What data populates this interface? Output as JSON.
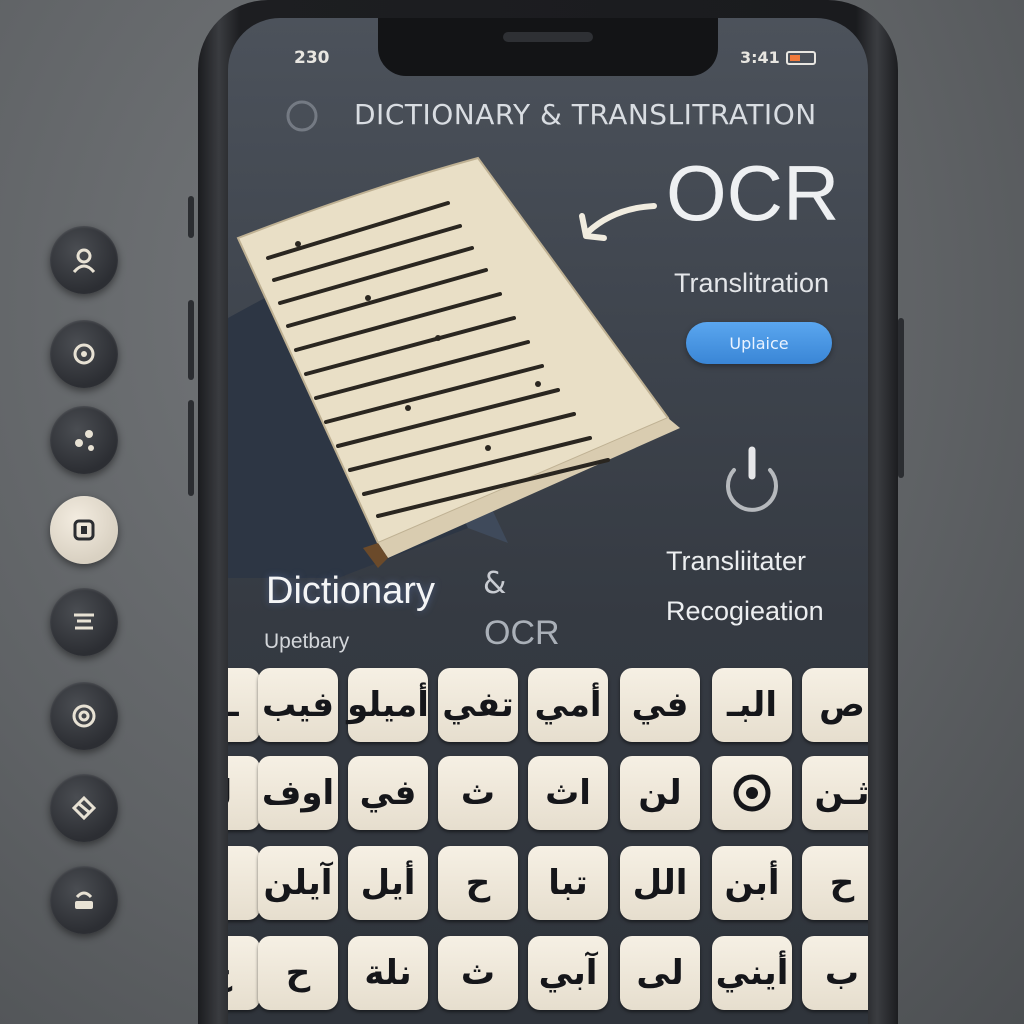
{
  "status_bar": {
    "time_left": "230",
    "time_right": "3:41"
  },
  "header": {
    "title": "DICTIONARY & TRANSLITRATION"
  },
  "ocr_panel": {
    "heading": "OCR",
    "subtitle": "Translitration",
    "button_label": "Uplaice"
  },
  "features": {
    "transliterate": "Transliitater",
    "recognition": "Recogieation"
  },
  "dictionary_section": {
    "heading": "Dictionary",
    "amp": "&",
    "ocr": "OCR",
    "subheading": "Upetbary"
  },
  "side_icons": [
    "user-icon",
    "settings-icon",
    "share-icon",
    "scan-icon",
    "language-icon",
    "target-icon",
    "globe-icon",
    "stack-icon"
  ],
  "keyboard": {
    "rows": [
      [
        "ـيـ",
        "فيب",
        "أميلو",
        "تفي",
        "أمي",
        "في",
        "البـ",
        "ص"
      ],
      [
        "لـ",
        "اوف",
        "في",
        "ث",
        "اث",
        "لن",
        "",
        "ثـن"
      ],
      [
        "ا",
        "آيلن",
        "أيل",
        "ح",
        "تبا",
        "الل",
        "أبن",
        "ح"
      ],
      [
        "ح",
        "ح",
        "نلة",
        "ث",
        "آبي",
        "لى",
        "أيني",
        "ب"
      ]
    ]
  },
  "colors": {
    "accent": "#3a86d6",
    "key_face": "#f1eadc",
    "screen": "#3d434c"
  }
}
